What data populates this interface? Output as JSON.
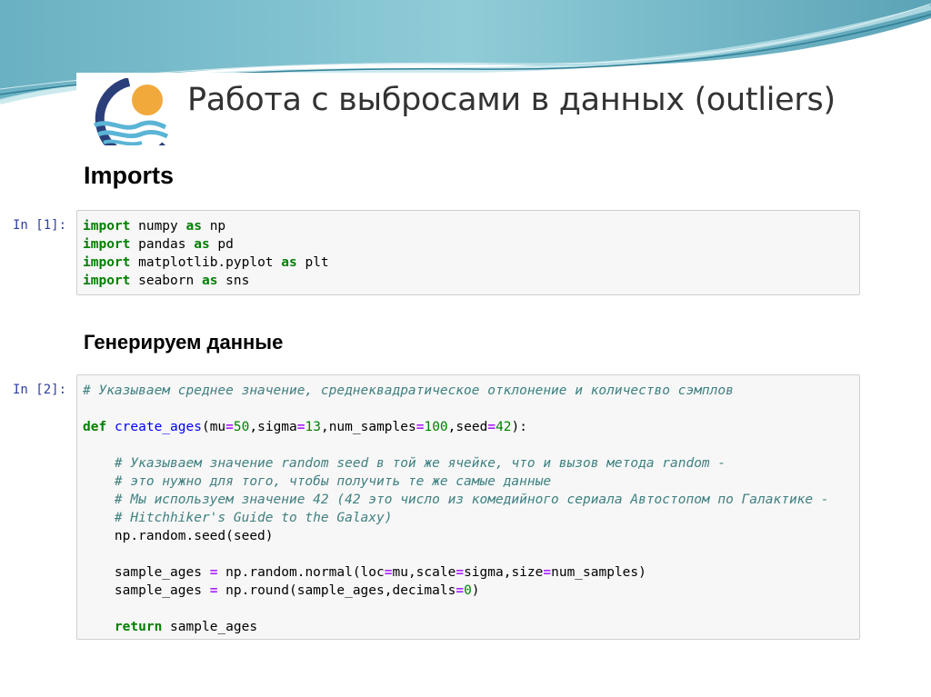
{
  "slide": {
    "title": "Работа с выбросами в данных (outliers)"
  },
  "notebook": {
    "headings": {
      "imports": "Imports",
      "generate": "Генерируем данные"
    },
    "cells": [
      {
        "prompt": "In [1]:",
        "lines": {
          "l1_kw": "import",
          "l1_mod": " numpy ",
          "l1_as": "as",
          "l1_alias": " np",
          "l2_kw": "import",
          "l2_mod": " pandas ",
          "l2_as": "as",
          "l2_alias": " pd",
          "l3_kw": "import",
          "l3_mod": " matplotlib.pyplot ",
          "l3_as": "as",
          "l3_alias": " plt",
          "l4_kw": "import",
          "l4_mod": " seaborn ",
          "l4_as": "as",
          "l4_alias": " sns"
        }
      },
      {
        "prompt": "In [2]:",
        "comment_header": "# Указываем среднее значение, среднеквадратическое отклонение и количество сэмплов",
        "def_kw": "def",
        "def_name": "create_ages",
        "def_p1": "(mu",
        "def_eq1": "=",
        "def_v1": "50",
        "def_p2": ",sigma",
        "def_eq2": "=",
        "def_v2": "13",
        "def_p3": ",num_samples",
        "def_eq3": "=",
        "def_v3": "100",
        "def_p4": ",seed",
        "def_eq4": "=",
        "def_v4": "42",
        "def_end": "):",
        "comment1": "# Указываем значение random seed в той же ячейке, что и вызов метода random -",
        "comment2": "# это нужно для того, чтобы получить те же самые данные",
        "comment3": "# Мы используем значение 42 (42 это число из комедийного сериала Автостопом по Галактике -",
        "comment4": "# Hitchhiker's Guide to the Galaxy)",
        "seed_line": "np.random.seed(seed)",
        "s1_a": "sample_ages ",
        "s1_eq": "=",
        "s1_b": " np.random.normal(loc",
        "s1_eq2": "=",
        "s1_c": "mu,scale",
        "s1_eq3": "=",
        "s1_d": "sigma,size",
        "s1_eq4": "=",
        "s1_e": "num_samples)",
        "s2_a": "sample_ages ",
        "s2_eq": "=",
        "s2_b": " np.round(sample_ages,decimals",
        "s2_eq2": "=",
        "s2_v": "0",
        "s2_end": ")",
        "ret_kw": "return",
        "ret_val": " sample_ages"
      }
    ]
  },
  "colors": {
    "keyword": "#008000",
    "comment": "#408080",
    "prompt": "#303f9f",
    "function_name": "#0000ff",
    "operator": "#aa22ff"
  }
}
